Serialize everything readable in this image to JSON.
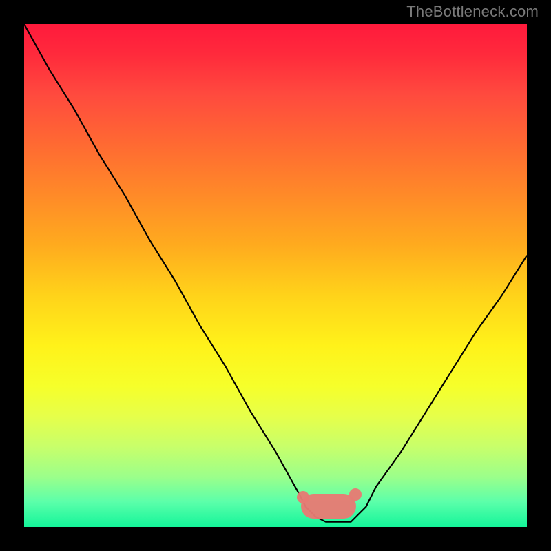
{
  "watermark": "TheBottleneck.com",
  "colors": {
    "background": "#000000",
    "curve": "#000000",
    "marker": "#e77b74",
    "gradient_top": "#ff1a3c",
    "gradient_bottom": "#14f59a"
  },
  "chart_data": {
    "type": "line",
    "title": "",
    "xlabel": "",
    "ylabel": "",
    "xlim": [
      0,
      100
    ],
    "ylim": [
      0,
      100
    ],
    "x": [
      0,
      5,
      10,
      15,
      20,
      25,
      30,
      35,
      40,
      45,
      50,
      55,
      56,
      58,
      60,
      62,
      64,
      65,
      66,
      68,
      70,
      75,
      80,
      85,
      90,
      95,
      100
    ],
    "values": [
      100,
      91,
      83,
      74,
      66,
      57,
      49,
      40,
      32,
      23,
      15,
      6,
      4,
      2,
      1,
      1,
      1,
      1,
      2,
      4,
      8,
      15,
      23,
      31,
      39,
      46,
      54
    ],
    "optimal_band": {
      "x_start": 55,
      "x_end": 66,
      "value": 1
    },
    "annotations": []
  }
}
